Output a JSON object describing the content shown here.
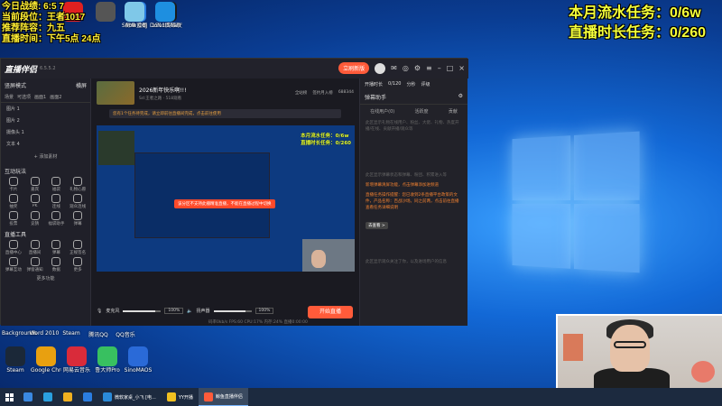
{
  "overlay": {
    "left_lines": [
      "今日战绩: 6:5 7",
      "当前段位：王者1017",
      "推荐阵容：九五",
      "直播时间：下午5点 24点"
    ],
    "right_lines": [
      "本月流水任务：0/6w",
      "直播时长任务：0/260"
    ]
  },
  "desktop_icons_top": [
    {
      "label": "",
      "color": "#e02020"
    },
    {
      "label": "",
      "color": "#555555"
    },
    {
      "label": "鲸鱼直播",
      "color": "#2a7de0"
    },
    {
      "label": "1511英雄联盟",
      "color": "#1a1a1a"
    },
    {
      "label": "Snow Obj",
      "color": "#7fc8e8"
    },
    {
      "label": "DoNotShare",
      "color": "#1e8fe0"
    }
  ],
  "desktop_icons_bottom": [
    {
      "label": "Steam",
      "color": "#1b2838"
    },
    {
      "label": "Google Chrome",
      "color": "#e8a010"
    },
    {
      "label": "网易云音乐",
      "color": "#d92b3a"
    },
    {
      "label": "鲁大师Pro",
      "color": "#38c060"
    },
    {
      "label": "SinoMAOS",
      "color": "#2a6ad8"
    }
  ],
  "desktop_labels_row": [
    "Backgrounds",
    "Word 2010",
    "Steam",
    "腾讯QQ",
    "QQ音乐"
  ],
  "app": {
    "brand": "直播伴侣",
    "version": "6.5.5.2",
    "top_pill": "立刷新版",
    "top_right": [
      "开播模板",
      "分享"
    ],
    "left": {
      "mode": "竖屏模式",
      "mode_switch": "横屏",
      "scene_tabs": [
        "场景",
        "可选项",
        "画面1",
        "画面2"
      ],
      "sources": [
        "图片 1",
        "图片 2",
        "摄像头 1",
        "文本 4"
      ],
      "add_source": "+ 添加素材",
      "interact_title": "互动玩法",
      "interact_items": [
        "卡片",
        "嘉宾",
        "福袋",
        "礼物心愿",
        "抽奖",
        "PK",
        "连线",
        "观众连线",
        "投票",
        "竞猜",
        "福袋助手",
        "弹幕"
      ],
      "tools_title": "直播工具",
      "tool_items": [
        "直播中心",
        "直播间",
        "弹幕",
        "正规签名",
        "弹幕互动",
        "弹窗通知",
        "数据",
        "更多"
      ],
      "more": "更多功能"
    },
    "center": {
      "live_title": "2026新年快乐啊!!!",
      "live_meta": "Sd:王者之路 · 518观看",
      "head_links": [
        "全站榜",
        "签约月入榜",
        "688344"
      ],
      "notice": "您有1个任务待完成，请立即前往直播间完成，点击前往使用",
      "preview_overlay": [
        "本月流水任务：0/6w",
        "直播时长任务：0/260"
      ],
      "preview_tip": "该分区不支持此播精准直播，不能在直播过程中切换",
      "mic_label": "麦克风",
      "mic_pct": "100%",
      "speaker_label": "扬声器",
      "speaker_pct": "100%",
      "mic_level": 0.85,
      "speaker_level": 0.85,
      "tool_labels": [
        "美颜",
        "录制",
        "设置"
      ],
      "start_button": "开始直播",
      "status": "码率0kb/s   FPS:60   CPU:17%   内存:24%   直播0:00:00"
    },
    "right": {
      "top_items": [
        "开播时长",
        "0/120",
        "分秒",
        "评级"
      ],
      "title": "弹幕助手",
      "tabs": [
        "在线用户(0)",
        "活跃度",
        "贡献"
      ],
      "hint1": "此区显示礼物在线用户、粉丝、大佬、礼物、热度开播/在线、贡献开播/观众等",
      "hint2": "此区显示弹幕状态和弹幕、粉团、积累进入等",
      "notice1": "新增弹幕清屏功能，点击弹幕添加进频道",
      "notice2": "直播任务操作提醒：您已收到2条直播平台政策的文件，产品名称：百战沙场。同之前两，点击前往直播查看任务详细说明",
      "link": "去查看 >",
      "hint3": "此区显示观众关注了你，以及进场用户的信息"
    }
  },
  "taskbar": {
    "items": [
      {
        "label": "",
        "color": "#3a88e0",
        "active": false
      },
      {
        "label": "",
        "color": "#2aa0e0",
        "active": false
      },
      {
        "label": "",
        "color": "#f0b020",
        "active": false
      },
      {
        "label": "",
        "color": "#2a7de0",
        "active": false
      },
      {
        "label": "微软家桌_小飞 [电...",
        "color": "#2a8ad8",
        "active": false
      },
      {
        "label": "YY开播",
        "color": "#f0c020",
        "active": false
      },
      {
        "label": "鲸鱼直播伴侣",
        "color": "#ff5b3a",
        "active": true
      }
    ]
  }
}
